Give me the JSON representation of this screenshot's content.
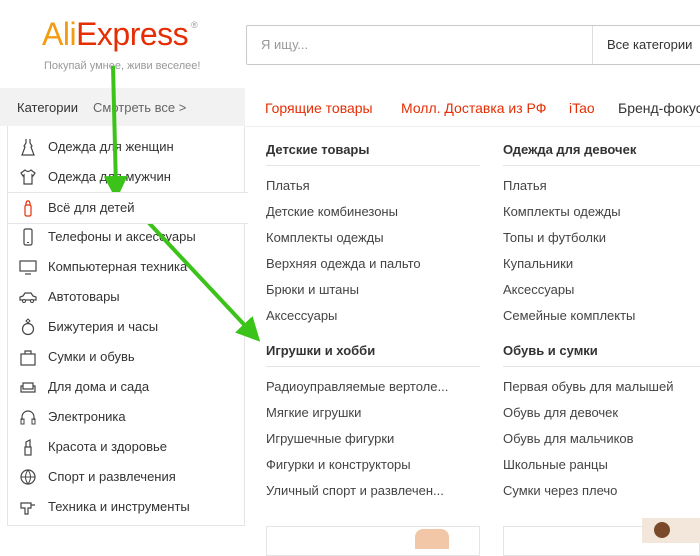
{
  "header": {
    "logo_a": "Ali",
    "logo_b": "Express",
    "tagline": "Покупай умнее, живи веселее!",
    "search_placeholder": "Я ищу...",
    "search_category": "Все категории"
  },
  "sidebar": {
    "title": "Категории",
    "see_all": "Смотреть все >",
    "items": [
      {
        "label": "Одежда для женщин",
        "icon": "dress-icon"
      },
      {
        "label": "Одежда для мужчин",
        "icon": "shirt-icon"
      },
      {
        "label": "Всё для детей",
        "icon": "baby-bottle-icon"
      },
      {
        "label": "Телефоны и аксессуары",
        "icon": "phone-icon"
      },
      {
        "label": "Компьютерная техника",
        "icon": "monitor-icon"
      },
      {
        "label": "Автотовары",
        "icon": "car-icon"
      },
      {
        "label": "Бижутерия и часы",
        "icon": "ring-icon"
      },
      {
        "label": "Сумки и обувь",
        "icon": "bag-icon"
      },
      {
        "label": "Для дома и сада",
        "icon": "sofa-icon"
      },
      {
        "label": "Электроника",
        "icon": "headphones-icon"
      },
      {
        "label": "Красота и здоровье",
        "icon": "lipstick-icon"
      },
      {
        "label": "Спорт и развлечения",
        "icon": "ball-icon"
      },
      {
        "label": "Техника и инструменты",
        "icon": "drill-icon"
      }
    ]
  },
  "topnav": [
    "Горящие товары",
    "Молл. Доставка из РФ",
    "iTao",
    "Бренд-фокус"
  ],
  "columns": {
    "left": [
      {
        "title": "Детские товары",
        "items": [
          "Платья",
          "Детские комбинезоны",
          "Комплекты одежды",
          "Верхняя одежда и пальто",
          "Брюки и штаны",
          "Аксессуары"
        ]
      },
      {
        "title": "Игрушки и хобби",
        "items": [
          "Радиоуправляемые вертоле...",
          "Мягкие игрушки",
          "Игрушечные фигурки",
          "Фигурки и конструкторы",
          "Уличный спорт и развлечен..."
        ]
      }
    ],
    "right": [
      {
        "title": "Одежда для девочек",
        "items": [
          "Платья",
          "Комплекты одежды",
          "Топы и футболки",
          "Купальники",
          "Аксессуары",
          "Семейные комплекты"
        ]
      },
      {
        "title": "Обувь и сумки",
        "items": [
          "Первая обувь для малышей",
          "Обувь для девочек",
          "Обувь для мальчиков",
          "Школьные ранцы",
          "Сумки через плечо"
        ]
      }
    ]
  },
  "colors": {
    "accent": "#e62e04",
    "logo_orange": "#f39c12",
    "arrow": "#3cc31a"
  }
}
